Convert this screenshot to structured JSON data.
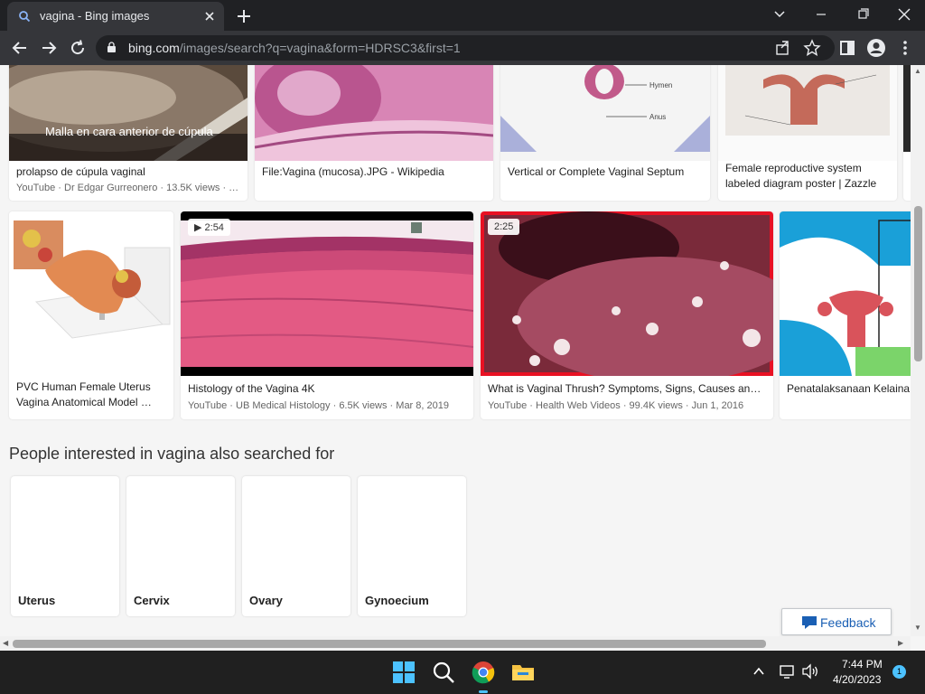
{
  "browser": {
    "tab_title": "vagina - Bing images",
    "url_domain": "bing.com",
    "url_path": "/images/search?q=vagina&form=HDRSC3&first=1"
  },
  "results_row1": [
    {
      "caption": "prolapso de cúpula vaginal",
      "meta": "YouTube · Dr Edgar Gurreonero · 13.5K views · …",
      "overlay_text": "Malla en cara anterior de cúpula"
    },
    {
      "caption": "File:Vagina (mucosa).JPG - Wikipedia"
    },
    {
      "caption": "Vertical or Complete Vaginal Septum",
      "diagram_labels": [
        "Hymen",
        "Anus"
      ]
    },
    {
      "caption": "Female reproductive system labeled diagram poster | Zazzle"
    }
  ],
  "results_row2": [
    {
      "caption": "PVC Human Female Uterus Vagina Anatomical Model …"
    },
    {
      "caption": "Histology of the Vagina 4K",
      "meta": "YouTube · UB Medical Histology · 6.5K views · Mar 8, 2019",
      "duration": "2:54"
    },
    {
      "caption": "What is Vaginal Thrush? Symptoms, Signs, Causes an…",
      "meta": "YouTube · Health Web Videos · 99.4K views · Jun 1, 2016",
      "duration": "2:25"
    },
    {
      "caption": "Penatalaksanaan Kelaina"
    }
  ],
  "related": {
    "title": "People interested in vagina also searched for",
    "items": [
      "Uterus",
      "Cervix",
      "Ovary",
      "Gynoecium"
    ]
  },
  "feedback_label": "Feedback",
  "taskbar": {
    "time": "7:44 PM",
    "date": "4/20/2023",
    "notification_count": "1"
  },
  "colors": {
    "chrome_dark": "#202124",
    "chrome_toolbar": "#35363a",
    "selected_border": "#e81123",
    "accent": "#1a5fb4"
  }
}
